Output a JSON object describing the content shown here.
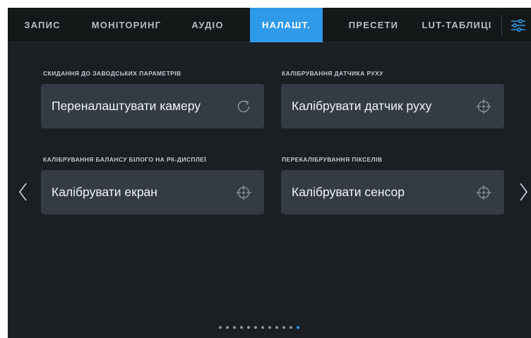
{
  "tabs": [
    {
      "label": "ЗАПИС",
      "active": false
    },
    {
      "label": "МОНІТОРИНГ",
      "active": false
    },
    {
      "label": "АУДІО",
      "active": false
    },
    {
      "label": "НАЛАШТ.",
      "active": true
    },
    {
      "label": "ПРЕСЕТИ",
      "active": false
    },
    {
      "label": "LUT-ТАБЛИЦІ",
      "active": false
    }
  ],
  "settings_icon": "sliders-icon",
  "sections": {
    "factory_reset": {
      "label": "СКИДАННЯ ДО ЗАВОДСЬКИХ ПАРАМЕТРІВ",
      "button": "Переналаштувати камеру",
      "icon": "refresh-icon"
    },
    "motion_sensor": {
      "label": "КАЛІБРУВАННЯ ДАТЧИКА РУХУ",
      "button": "Калібрувати датчик руху",
      "icon": "crosshair-icon"
    },
    "lcd_white_balance": {
      "label": "КАЛІБРУВАННЯ БАЛАНСУ БІЛОГО НА РК-ДИСПЛЕЇ",
      "button": "Калібрувати екран",
      "icon": "crosshair-icon"
    },
    "pixel_recalibration": {
      "label": "ПЕРЕКАЛІБРУВАННЯ ПІКСЕЛІВ",
      "button": "Калібрувати сенсор",
      "icon": "crosshair-icon"
    }
  },
  "pager": {
    "total": 12,
    "active_index": 11
  },
  "colors": {
    "accent": "#2f9ae8",
    "background": "#1b1f24",
    "button": "#343b44"
  }
}
